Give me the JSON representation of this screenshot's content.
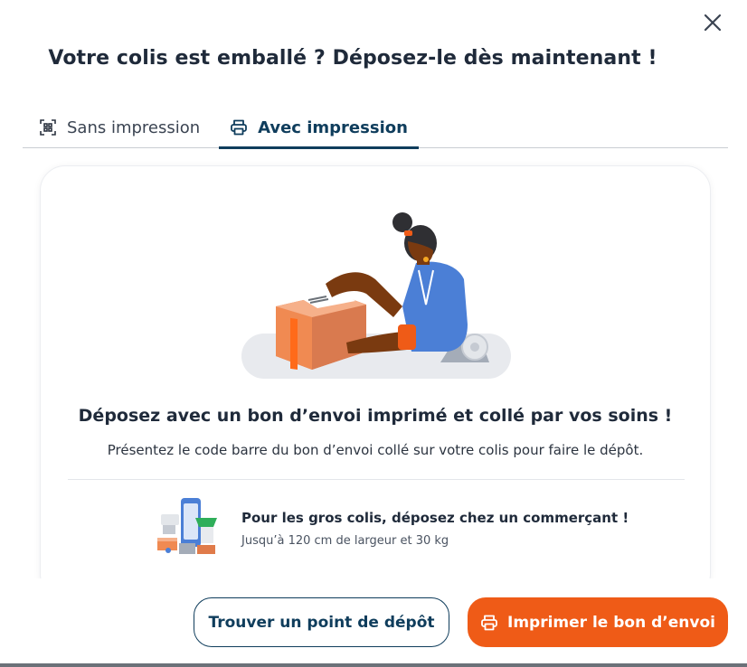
{
  "modal": {
    "title": "Votre colis est emballé ? Déposez-le dès maintenant !",
    "close_icon": "close-icon"
  },
  "tabs": [
    {
      "label": "Sans impression",
      "icon": "qr-scan-icon",
      "active": false
    },
    {
      "label": "Avec impression",
      "icon": "printer-icon",
      "active": true
    }
  ],
  "card": {
    "heading": "Déposez avec un bon d’envoi imprimé et collé par vos soins !",
    "subtext": "Présentez le code barre du bon d’envoi collé sur votre colis pour faire le dépôt.",
    "tip": {
      "title": "Pour les gros colis, déposez chez un commerçant !",
      "subtitle": "Jusqu’à 120 cm de largeur et 30 kg"
    }
  },
  "footer": {
    "find_button": "Trouver un point de dépôt",
    "print_button": "Imprimer le bon d’envoi"
  },
  "colors": {
    "primary_navy": "#0f3d5c",
    "accent_orange": "#ef5b17",
    "text_dark": "#1f2a3a"
  }
}
